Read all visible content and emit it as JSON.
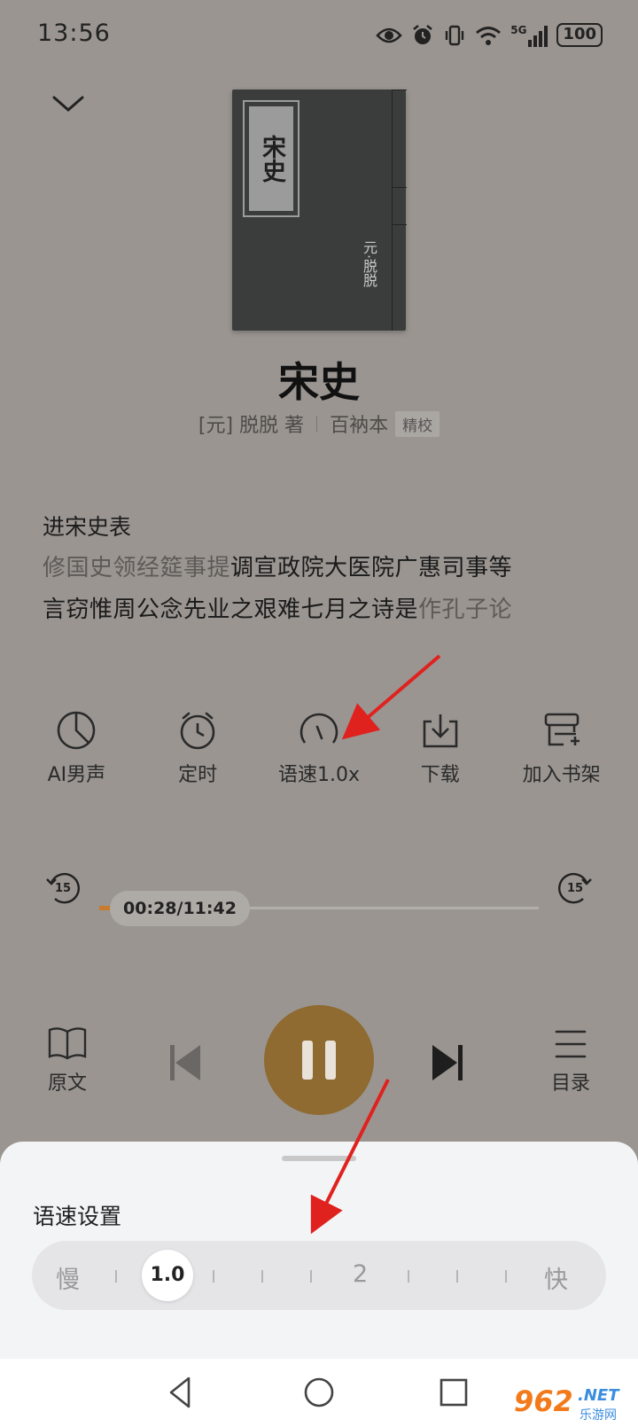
{
  "status_bar": {
    "time": "13:56",
    "network": "5G",
    "battery": "100",
    "icons": [
      "eye-icon",
      "alarm-icon",
      "vibrate-icon",
      "wifi-icon",
      "signal-icon",
      "battery-icon"
    ]
  },
  "book": {
    "cover_label": "宋史",
    "cover_author": "元·脱脱",
    "title": "宋史",
    "author": "[元] 脱脱 著",
    "edition": "百衲本",
    "tag": "精校"
  },
  "reader": {
    "chapter_title": "进宋史表",
    "line1_dim": "修国史领经筵事提",
    "line1_bright": "调宣政院大医院广惠司事等",
    "line2_bright": "言窃惟周公念先业之艰难七月之诗是",
    "line2_dim": "作孔子论"
  },
  "features": [
    {
      "label": "AI男声",
      "icon": "ai-voice-icon"
    },
    {
      "label": "定时",
      "icon": "timer-icon"
    },
    {
      "label": "语速1.0x",
      "icon": "speed-gauge-icon"
    },
    {
      "label": "下载",
      "icon": "download-icon"
    },
    {
      "label": "加入书架",
      "icon": "add-bookshelf-icon"
    }
  ],
  "player": {
    "time": "00:28/11:42",
    "progress": 0.04,
    "rewind_seconds": "15",
    "forward_seconds": "15",
    "original_label": "原文",
    "toc_label": "目录"
  },
  "speed_sheet": {
    "title": "语速设置",
    "slow_label": "慢",
    "fast_label": "快",
    "mid_label": "2",
    "current_value": "1.0"
  },
  "watermark": {
    "number": "962",
    "suffix": ".NET",
    "sub": "乐游网"
  },
  "colors": {
    "accent": "#8f6a31",
    "progress": "#c97a2a",
    "annotation_arrow": "#e0221f"
  }
}
